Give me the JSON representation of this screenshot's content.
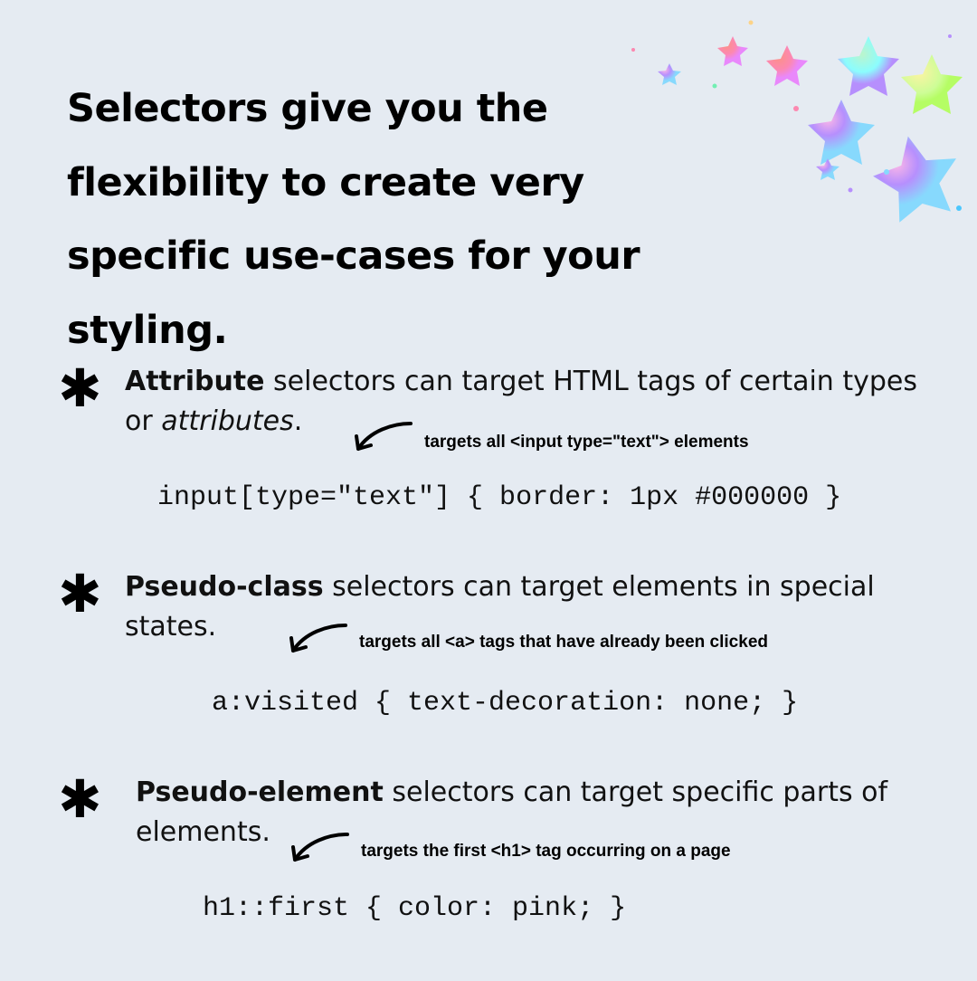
{
  "heading": "Selectors give you the flexibility to create very specific use-cases for your styling.",
  "items": [
    {
      "bold": "Attribute",
      "rest_before_italic": " selectors can target HTML tags of certain types or ",
      "italic": "attributes",
      "rest_after_italic": ".",
      "annotation": "targets all <input type=\"text\"> elements",
      "code": "input[type=\"text\"] { border: 1px #000000 }"
    },
    {
      "bold": "Pseudo-class",
      "rest_before_italic": " selectors can target elements in special states.",
      "italic": "",
      "rest_after_italic": "",
      "annotation": "targets all <a> tags that have already been clicked",
      "code": "a:visited { text-decoration: none; }"
    },
    {
      "bold": "Pseudo-element",
      "rest_before_italic": " selectors can target specific parts of elements.",
      "italic": "",
      "rest_after_italic": "",
      "annotation": "targets the first <h1> tag occurring on a page",
      "code": "h1::first { color: pink; }"
    }
  ]
}
